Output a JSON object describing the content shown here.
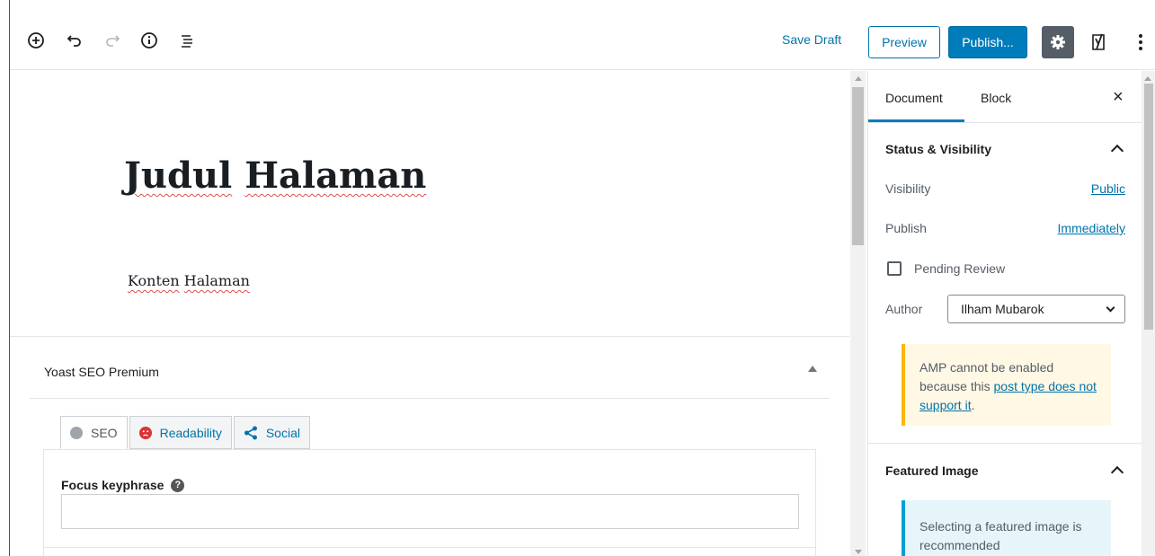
{
  "toolbar": {
    "icons": [
      "add-block-icon",
      "undo-icon",
      "redo-icon",
      "info-icon",
      "block-navigation-icon",
      "settings-gear-icon",
      "yoast-icon",
      "more-options-icon"
    ],
    "save_draft": "Save Draft",
    "preview": "Preview",
    "publish": "Publish..."
  },
  "editor": {
    "title_words": [
      "Judul",
      "Halaman"
    ],
    "content_words": [
      "Konten",
      "Halaman"
    ]
  },
  "yoast": {
    "title": "Yoast SEO Premium",
    "tabs": [
      {
        "label": "SEO",
        "icon": "grey-circle-icon"
      },
      {
        "label": "Readability",
        "icon": "sad-face-icon"
      },
      {
        "label": "Social",
        "icon": "share-icon"
      }
    ],
    "focus_keyphrase_label": "Focus keyphrase",
    "focus_keyphrase_value": ""
  },
  "sidebar": {
    "tabs": [
      "Document",
      "Block"
    ],
    "close": "×",
    "status_title": "Status & Visibility",
    "visibility_label": "Visibility",
    "visibility_value": "Public",
    "publish_label": "Publish",
    "publish_value": "Immediately",
    "pending_review": "Pending Review",
    "pending_review_checked": false,
    "author_label": "Author",
    "author_value": "Ilham Mubarok",
    "amp_notice_text": "AMP cannot be enabled because this",
    "amp_notice_link": "post type does not support it",
    "amp_notice_end": ".",
    "featured_title": "Featured Image",
    "featured_notice": "Selecting a featured image is recommended"
  },
  "colors": {
    "accent": "#007cba",
    "link": "#0073aa",
    "warning": "#ffb900",
    "info": "#00a0d2",
    "readability_bad": "#dc3232"
  }
}
